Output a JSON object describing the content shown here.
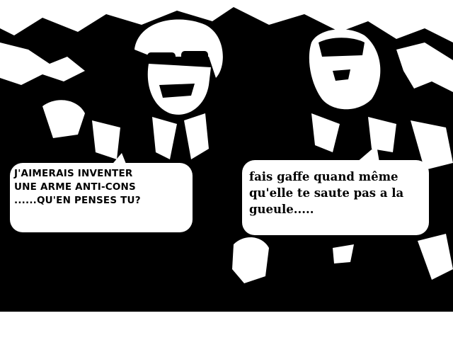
{
  "colors": {
    "ink": "#000000",
    "paper": "#ffffff"
  },
  "speech_left": {
    "lines": [
      "J'AIMERAIS INVENTER",
      "UNE ARME ANTI-CONS",
      "......QU'EN PENSES TU?"
    ]
  },
  "speech_right": {
    "lines": [
      "fais gaffe quand même",
      "qu'elle te saute pas a la",
      "gueule....."
    ]
  }
}
